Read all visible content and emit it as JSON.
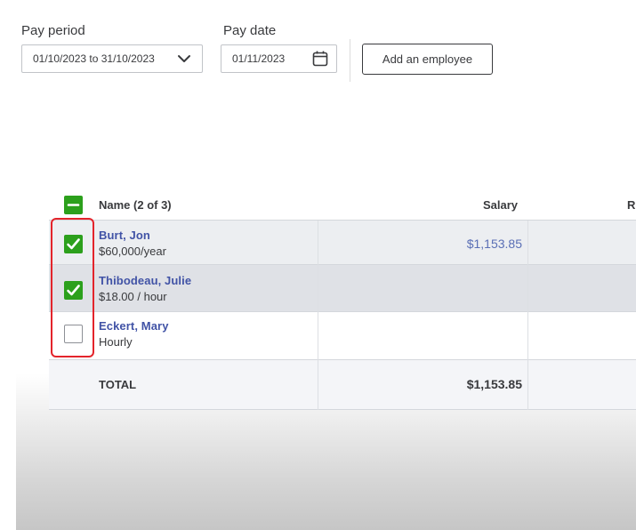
{
  "pay_period": {
    "label": "Pay period",
    "value": "01/10/2023 to 31/10/2023"
  },
  "pay_date": {
    "label": "Pay date",
    "value": "01/11/2023"
  },
  "add_employee_label": "Add an employee",
  "table": {
    "columns": {
      "name": "Name (2 of 3)",
      "salary": "Salary",
      "next_partial": "R"
    },
    "rows": [
      {
        "name": "Burt, Jon",
        "rate": "$60,000/year",
        "salary": "$1,153.85",
        "checked": true
      },
      {
        "name": "Thibodeau, Julie",
        "rate": "$18.00 / hour",
        "salary": "",
        "checked": true
      },
      {
        "name": "Eckert, Mary",
        "rate": "Hourly",
        "salary": "",
        "checked": false
      }
    ],
    "total": {
      "label": "TOTAL",
      "salary": "$1,153.85"
    }
  },
  "colors": {
    "check_green": "#2ca01c",
    "link_blue": "#4153a6",
    "highlight_red": "#e3242b"
  },
  "icons": {
    "select_all": "minus-icon",
    "checked": "check-icon",
    "period_dropdown": "chevron-down-icon",
    "date_picker": "calendar-icon"
  }
}
